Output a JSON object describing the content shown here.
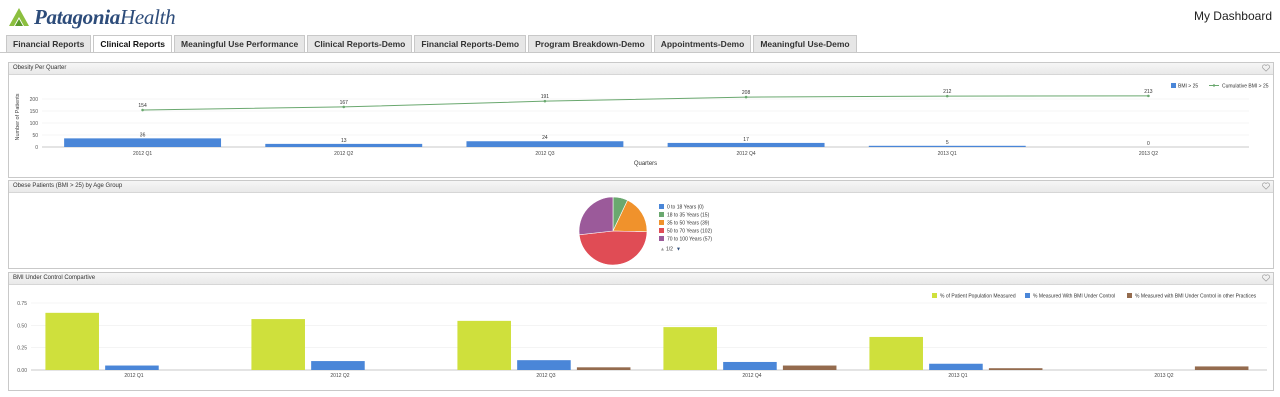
{
  "header": {
    "logo_bold": "Patagonia",
    "logo_light": "Health",
    "my_dashboard": "My Dashboard"
  },
  "tabs": [
    {
      "label": "Financial Reports",
      "active": false
    },
    {
      "label": "Clinical Reports",
      "active": true
    },
    {
      "label": "Meaningful Use Performance",
      "active": false
    },
    {
      "label": "Clinical Reports-Demo",
      "active": false
    },
    {
      "label": "Financial Reports-Demo",
      "active": false
    },
    {
      "label": "Program Breakdown-Demo",
      "active": false
    },
    {
      "label": "Appointments-Demo",
      "active": false
    },
    {
      "label": "Meaningful Use-Demo",
      "active": false
    }
  ],
  "panels": {
    "obesity": {
      "title": "Obesity Per Quarter"
    },
    "age": {
      "title": "Obese Patients (BMI > 25) by Age Group"
    },
    "bmi": {
      "title": "BMI Under Control Compartive"
    }
  },
  "chart_data": [
    {
      "type": "bar",
      "title": "Obesity Per Quarter",
      "xlabel": "Quarters",
      "ylabel": "Number of Patients",
      "categories": [
        "2012 Q1",
        "2012 Q2",
        "2012 Q3",
        "2012 Q4",
        "2013 Q1",
        "2013 Q2"
      ],
      "series": [
        {
          "name": "BMI > 25",
          "kind": "bar",
          "color": "#4a86d8",
          "values": [
            36,
            13,
            24,
            17,
            5,
            0
          ]
        },
        {
          "name": "Cumulative BMI > 25",
          "kind": "line",
          "color": "#6aa86f",
          "values": [
            154,
            167,
            191,
            208,
            212,
            213
          ]
        }
      ],
      "ylim": [
        0,
        250
      ],
      "yticks": [
        0,
        50,
        100,
        150,
        200
      ],
      "legend": "top-right"
    },
    {
      "type": "pie",
      "title": "Obese Patients (BMI > 25) by Age Group",
      "slices": [
        {
          "label": "0 to 18 Years (0)",
          "value": 0,
          "color": "#4a86d8"
        },
        {
          "label": "18 to 35 Years (15)",
          "value": 15,
          "color": "#6aa86f"
        },
        {
          "label": "35 to 50 Years (39)",
          "value": 39,
          "color": "#f0922c"
        },
        {
          "label": "50 to 70 Years (102)",
          "value": 102,
          "color": "#e04c55"
        },
        {
          "label": "70 to 100 Years (57)",
          "value": 57,
          "color": "#9b5a9a"
        }
      ],
      "legend_visible": [
        "0 to 18 Years (0)",
        "18 to 35 Years (15)",
        "35 to 50 Years (39)",
        "50 to 70 Years (102)",
        "70 to 100 Years (57)"
      ],
      "legend_pager": "1/2",
      "legend": "right"
    },
    {
      "type": "bar",
      "title": "BMI Under Control Compartive",
      "categories": [
        "2012 Q1",
        "2012 Q2",
        "2012 Q3",
        "2012 Q4",
        "2013 Q1",
        "2013 Q2"
      ],
      "series": [
        {
          "name": "% of Patient Population Measured",
          "color": "#cfe03c",
          "values": [
            0.64,
            0.57,
            0.55,
            0.48,
            0.37,
            0
          ]
        },
        {
          "name": "% Measured With BMI Under Control",
          "color": "#4a86d8",
          "values": [
            0.05,
            0.1,
            0.11,
            0.09,
            0.07,
            0
          ]
        },
        {
          "name": "% Measured with BMI Under Control in other Practices",
          "color": "#946b4e",
          "values": [
            0,
            0,
            0.03,
            0.05,
            0.02,
            0.04
          ]
        }
      ],
      "ylim": [
        0,
        0.75
      ],
      "yticks": [
        "0.00",
        "0.25",
        "0.50",
        "0.75"
      ],
      "legend": "top-right"
    }
  ]
}
